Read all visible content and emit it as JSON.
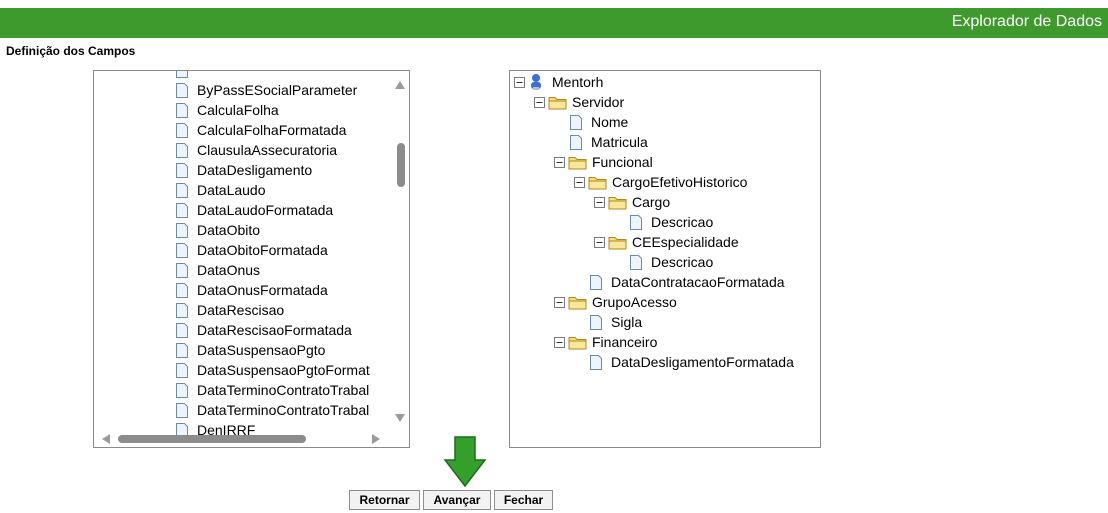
{
  "header": {
    "title": "Explorador de Dados"
  },
  "section": {
    "title": "Definição dos Campos"
  },
  "available_fields": {
    "items": [
      "ByPassESocialParameter",
      "CalculaFolha",
      "CalculaFolhaFormatada",
      "ClausulaAssecuratoria",
      "DataDesligamento",
      "DataLaudo",
      "DataLaudoFormatada",
      "DataObito",
      "DataObitoFormatada",
      "DataOnus",
      "DataOnusFormatada",
      "DataRescisao",
      "DataRescisaoFormatada",
      "DataSuspensaoPgto",
      "DataSuspensaoPgtoFormat",
      "DataTerminoContratoTrabal",
      "DataTerminoContratoTrabal",
      "DenIRRF"
    ]
  },
  "selected_tree": {
    "root": "Mentorh",
    "servidor": "Servidor",
    "nome": "Nome",
    "matricula": "Matricula",
    "funcional": "Funcional",
    "cargo_efetivo_historico": "CargoEfetivoHistorico",
    "cargo": "Cargo",
    "cargo_descricao": "Descricao",
    "ce_especialidade": "CEEspecialidade",
    "ce_descricao": "Descricao",
    "data_contratacao": "DataContratacaoFormatada",
    "grupo_acesso": "GrupoAcesso",
    "sigla": "Sigla",
    "financeiro": "Financeiro",
    "data_desligamento_formatada": "DataDesligamentoFormatada"
  },
  "buttons": {
    "retornar": "Retornar",
    "avancar": "Avançar",
    "fechar": "Fechar"
  },
  "colors": {
    "header_green": "#3f9a2d",
    "arrow_green": "#33a02c",
    "folder_yellow": "#f5d76e"
  },
  "icons": {
    "document": "document-icon",
    "folder": "folder-icon",
    "expand": "minus-box-icon",
    "root": "user-icon"
  }
}
